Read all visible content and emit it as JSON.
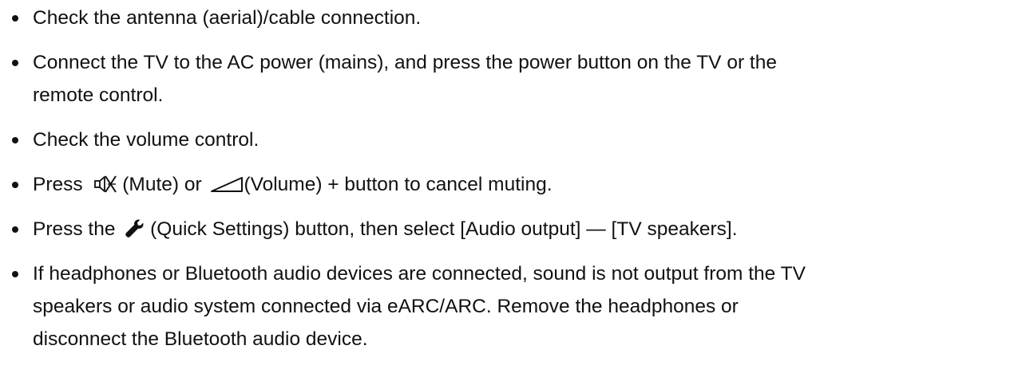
{
  "items": [
    {
      "text": "Check the antenna (aerial)/cable connection."
    },
    {
      "line1": "Connect the TV to the AC power (mains), and press the power button on the TV or the",
      "line2": "remote control."
    },
    {
      "text": "Check the volume control."
    },
    {
      "before": "Press ",
      "mute_label": " (Mute) or ",
      "after": "(Volume) + button to cancel muting."
    },
    {
      "before": "Press the ",
      "after": " (Quick Settings) button, then select [Audio output] — [TV speakers]."
    },
    {
      "line1": "If headphones or Bluetooth audio devices are connected, sound is not output from the TV",
      "line2": "speakers or audio system connected via eARC/ARC. Remove the headphones or",
      "line3": "disconnect the Bluetooth audio device."
    }
  ],
  "icons": {
    "mute": "mute-icon",
    "volume": "volume-ramp-icon",
    "quick_settings": "wrench-icon"
  }
}
